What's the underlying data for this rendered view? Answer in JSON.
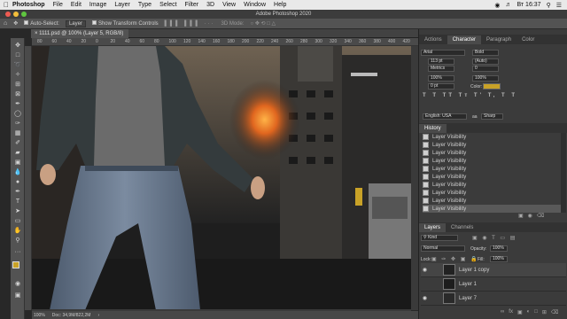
{
  "mac_menu": {
    "app": "Photoshop",
    "items": [
      "File",
      "Edit",
      "Image",
      "Layer",
      "Type",
      "Select",
      "Filter",
      "3D",
      "View",
      "Window",
      "Help"
    ],
    "clock": "Вт 16:37"
  },
  "window": {
    "title": "Adobe Photoshop 2020"
  },
  "options_bar": {
    "auto_select_label": "Auto-Select:",
    "auto_select_value": "Layer",
    "transform_label": "Show Transform Controls",
    "mode_3d_label": "3D Mode:"
  },
  "document": {
    "tab_title": "1111.psd @ 100% (Layer 5, RGB/8)"
  },
  "ruler": {
    "ticks": [
      "80",
      "60",
      "40",
      "20",
      "0",
      "20",
      "40",
      "60",
      "80",
      "100",
      "120",
      "140",
      "160",
      "180",
      "200",
      "220",
      "240",
      "260",
      "280",
      "300",
      "320",
      "340",
      "360",
      "380",
      "400",
      "420"
    ]
  },
  "status_bar": {
    "zoom": "100%",
    "doc_size": "Doc: 34,9M/822,2M"
  },
  "character_panel": {
    "tabs": [
      "Actions",
      "Character",
      "Paragraph",
      "Color"
    ],
    "font_family": "Arial",
    "font_style": "Bold",
    "font_size": "113 pt",
    "leading": "(Auto)",
    "kerning": "Metrics",
    "tracking": "0",
    "vertical_scale": "100%",
    "horizontal_scale": "100%",
    "baseline_shift": "0 pt",
    "color_label": "Color:",
    "color_value": "#c9a227",
    "language": "English: USA",
    "antialias_label": "aa",
    "antialias": "Sharp"
  },
  "history_panel": {
    "tab": "History",
    "items": [
      "Layer Visibility",
      "Layer Visibility",
      "Layer Visibility",
      "Layer Visibility",
      "Layer Visibility",
      "Layer Visibility",
      "Layer Visibility",
      "Layer Visibility",
      "Layer Visibility",
      "Layer Visibility"
    ]
  },
  "layers_panel": {
    "tabs": [
      "Layers",
      "Channels"
    ],
    "kind_label": "Kind",
    "blend_mode": "Normal",
    "opacity_label": "Opacity:",
    "opacity": "100%",
    "lock_label": "Lock:",
    "fill_label": "Fill:",
    "fill": "100%",
    "layers": [
      "Layer 1 copy",
      "Layer 1",
      "Layer 7"
    ]
  },
  "icons": [
    "apple-icon",
    "move-icon",
    "marquee-icon",
    "lasso-icon",
    "quick-select-icon",
    "crop-icon",
    "eyedropper-icon",
    "healing-icon",
    "brush-icon",
    "stamp-icon",
    "history-brush-icon",
    "eraser-icon",
    "gradient-icon",
    "blur-icon",
    "dodge-icon",
    "pen-icon",
    "type-icon",
    "path-select-icon",
    "shape-icon",
    "hand-icon",
    "zoom-icon",
    "eye-icon"
  ]
}
